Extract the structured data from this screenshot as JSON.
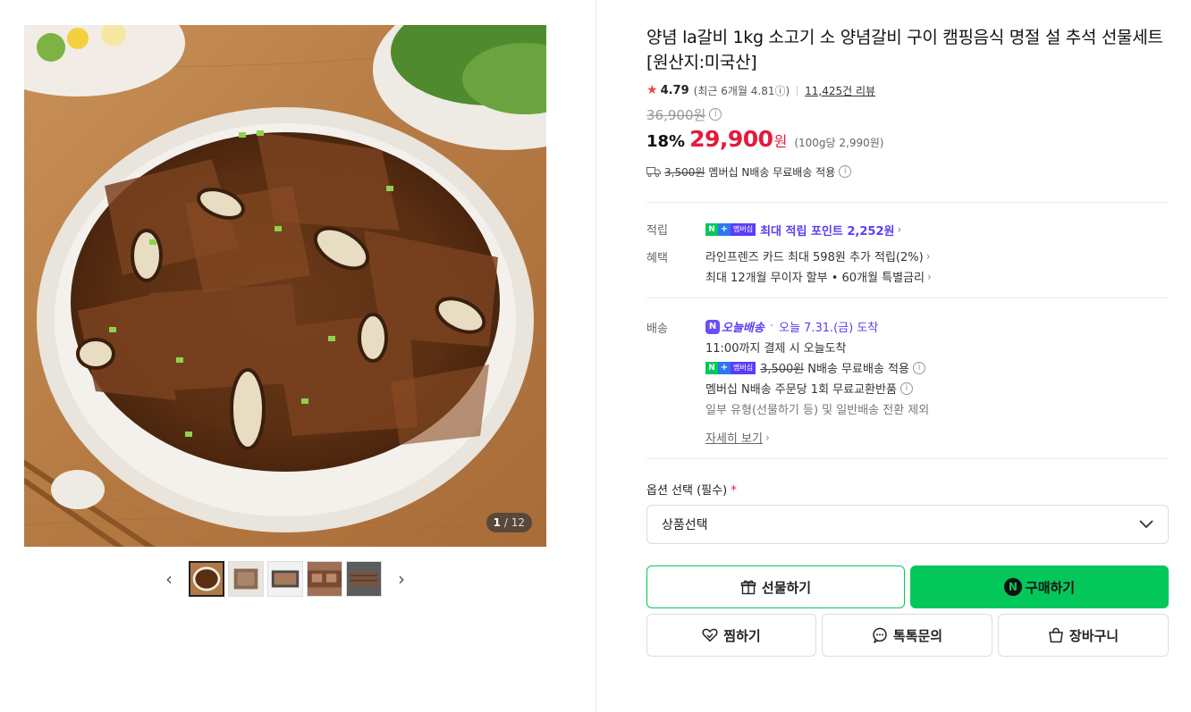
{
  "gallery": {
    "counter_current": "1",
    "counter_total": "/ 12",
    "thumbnail_count": 5
  },
  "product": {
    "title": "양념 la갈비 1kg 소고기 소 양념갈비 구이 캠핑음식 명절 설 추석 선물세트 [원산지:미국산]",
    "rating": "4.79",
    "recent_rating": "(최근 6개월 4.81ⓘ)",
    "review_count": "11,425건 리뷰",
    "original_price": "36,900원",
    "discount": "18%",
    "price": "29,900",
    "price_unit": "원",
    "unit_price": "(100g당 2,990원)",
    "shipping_strike": "3,500원",
    "shipping_text": "멤버십 N배송 무료배송 적용"
  },
  "points": {
    "label": "적립",
    "badge_n": "N",
    "badge_plus": "+",
    "badge_member": "멤버십",
    "text": "최대 적립 포인트 2,252원"
  },
  "benefits": {
    "label": "혜택",
    "line1": "라인프렌즈 카드 최대 598원 추가 적립(2%)",
    "line2": "최대 12개월 무이자 할부 • 60개월 특별금리"
  },
  "delivery": {
    "label": "배송",
    "badge": "오늘배송",
    "badge_n": "N",
    "arrival": "오늘 7.31.(금) 도착",
    "cutoff": "11:00까지 결제 시 오늘도착",
    "free_strike": "3,500원",
    "free_text": "N배송 무료배송 적용",
    "exchange": "멤버십 N배송 주문당 1회 무료교환반품",
    "note": "일부 유형(선물하기 등) 및 일반배송 전환 제외",
    "more": "자세히 보기"
  },
  "options": {
    "label": "옵션 선택 (필수)",
    "required_mark": "*",
    "select_value": "상품선택"
  },
  "buttons": {
    "gift": "선물하기",
    "buy": "구매하기",
    "buy_icon_letter": "N",
    "wish": "찜하기",
    "talk": "톡톡문의",
    "cart": "장바구니"
  },
  "colors": {
    "price_red": "#e51a3c",
    "naver_green": "#03c75a",
    "membership_purple": "#5b3ef6"
  }
}
